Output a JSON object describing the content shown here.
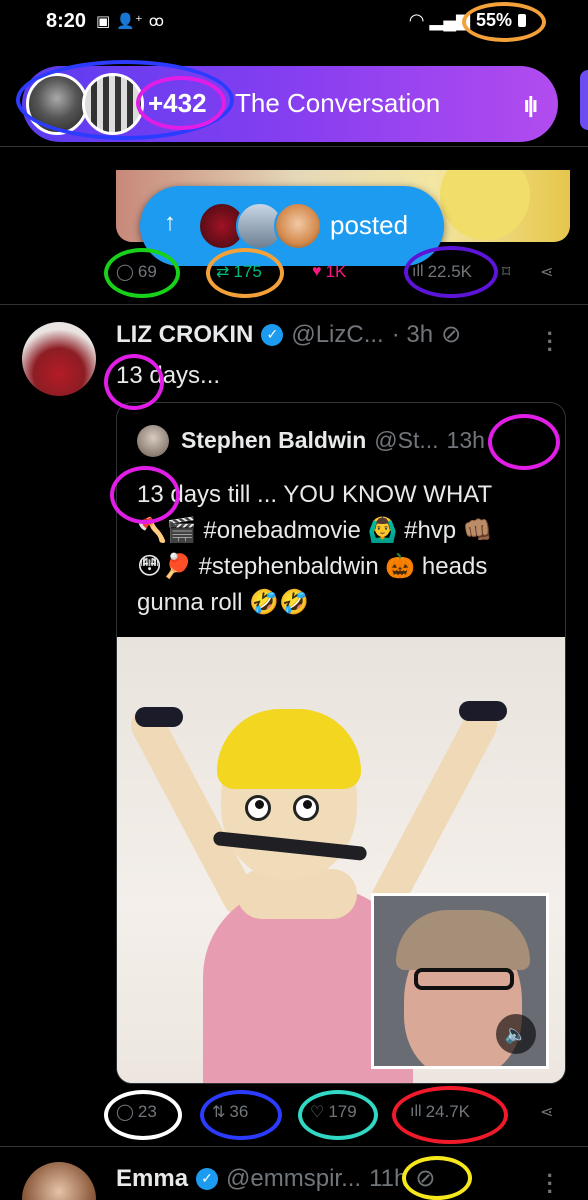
{
  "status_bar": {
    "time": "8:20",
    "left_icons": [
      "photo-icon",
      "person-add-icon",
      "voicemail-icon"
    ],
    "battery": "55%"
  },
  "conversation": {
    "count": "+432",
    "title": "The Conversation",
    "accent_start": "#5b3cf0",
    "accent_end": "#b24cef"
  },
  "posted_pill": {
    "label": "posted",
    "color": "#1d9bf0"
  },
  "prev_tweet_actions": {
    "replies": "69",
    "reposts": "175",
    "likes": "1K",
    "views": "22.5K"
  },
  "tweet": {
    "name": "LIZ CROKIN",
    "handle": "@LizC...",
    "time": "· 3h",
    "text": "13 days...",
    "quote": {
      "name": "Stephen Baldwin",
      "handle": "@St...",
      "time": "13h",
      "line1": "13 days till ... YOU KNOW WHAT",
      "line2": "🪓🎬 #onebadmovie 🙆‍♂️ #hvp 👊🏽",
      "line3": "😳🏓 #stephenbaldwin 🎃 heads",
      "line4": "gunna roll 🤣🤣"
    },
    "actions": {
      "replies": "23",
      "reposts": "36",
      "likes": "179",
      "views": "24.7K"
    }
  },
  "next_tweet": {
    "name": "Emma",
    "handle": "@emmspir...",
    "time": "11h"
  },
  "annotation_colors": {
    "orange": "#f5a13a",
    "blue": "#2b3cff",
    "magenta": "#e11ee6",
    "green": "#18d21a",
    "purple": "#5c14d8",
    "white": "#ffffff",
    "cyan": "#31d8c4",
    "red": "#f01a2a",
    "yellow": "#f7e81e"
  }
}
